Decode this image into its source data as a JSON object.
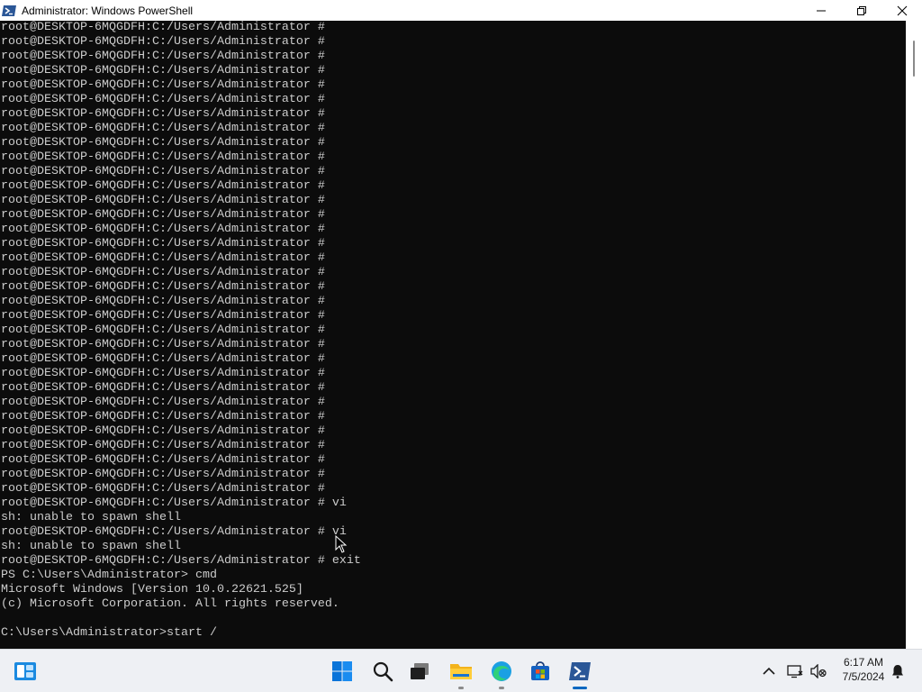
{
  "window": {
    "title": "Administrator: Windows PowerShell",
    "icon": "powershell-icon",
    "controls": [
      "minimize-icon",
      "restore-icon",
      "close-icon"
    ]
  },
  "terminal": {
    "lines": [
      "root@DESKTOP-6MQGDFH:C:/Users/Administrator #",
      "root@DESKTOP-6MQGDFH:C:/Users/Administrator #",
      "root@DESKTOP-6MQGDFH:C:/Users/Administrator #",
      "root@DESKTOP-6MQGDFH:C:/Users/Administrator #",
      "root@DESKTOP-6MQGDFH:C:/Users/Administrator #",
      "root@DESKTOP-6MQGDFH:C:/Users/Administrator #",
      "root@DESKTOP-6MQGDFH:C:/Users/Administrator #",
      "root@DESKTOP-6MQGDFH:C:/Users/Administrator #",
      "root@DESKTOP-6MQGDFH:C:/Users/Administrator #",
      "root@DESKTOP-6MQGDFH:C:/Users/Administrator #",
      "root@DESKTOP-6MQGDFH:C:/Users/Administrator #",
      "root@DESKTOP-6MQGDFH:C:/Users/Administrator #",
      "root@DESKTOP-6MQGDFH:C:/Users/Administrator #",
      "root@DESKTOP-6MQGDFH:C:/Users/Administrator #",
      "root@DESKTOP-6MQGDFH:C:/Users/Administrator #",
      "root@DESKTOP-6MQGDFH:C:/Users/Administrator #",
      "root@DESKTOP-6MQGDFH:C:/Users/Administrator #",
      "root@DESKTOP-6MQGDFH:C:/Users/Administrator #",
      "root@DESKTOP-6MQGDFH:C:/Users/Administrator #",
      "root@DESKTOP-6MQGDFH:C:/Users/Administrator #",
      "root@DESKTOP-6MQGDFH:C:/Users/Administrator #",
      "root@DESKTOP-6MQGDFH:C:/Users/Administrator #",
      "root@DESKTOP-6MQGDFH:C:/Users/Administrator #",
      "root@DESKTOP-6MQGDFH:C:/Users/Administrator #",
      "root@DESKTOP-6MQGDFH:C:/Users/Administrator #",
      "root@DESKTOP-6MQGDFH:C:/Users/Administrator #",
      "root@DESKTOP-6MQGDFH:C:/Users/Administrator #",
      "root@DESKTOP-6MQGDFH:C:/Users/Administrator #",
      "root@DESKTOP-6MQGDFH:C:/Users/Administrator #",
      "root@DESKTOP-6MQGDFH:C:/Users/Administrator #",
      "root@DESKTOP-6MQGDFH:C:/Users/Administrator #",
      "root@DESKTOP-6MQGDFH:C:/Users/Administrator #",
      "root@DESKTOP-6MQGDFH:C:/Users/Administrator #",
      "root@DESKTOP-6MQGDFH:C:/Users/Administrator # vi",
      "sh: unable to spawn shell",
      "root@DESKTOP-6MQGDFH:C:/Users/Administrator # vi",
      "sh: unable to spawn shell",
      "root@DESKTOP-6MQGDFH:C:/Users/Administrator # exit",
      "PS C:\\Users\\Administrator> cmd",
      "Microsoft Windows [Version 10.0.22621.525]",
      "(c) Microsoft Corporation. All rights reserved.",
      "",
      "C:\\Users\\Administrator>start /"
    ],
    "colors": {
      "background": "#0c0c0c",
      "foreground": "#cccccc"
    }
  },
  "taskbar": {
    "widgets_icon": "widgets-icon",
    "apps": [
      {
        "name": "start-button",
        "icon": "windows-start-icon",
        "active": false
      },
      {
        "name": "search-button",
        "icon": "search-icon",
        "active": false
      },
      {
        "name": "task-view-button",
        "icon": "task-view-icon",
        "active": false
      },
      {
        "name": "file-explorer-button",
        "icon": "folder-icon",
        "active": false,
        "running": true
      },
      {
        "name": "edge-button",
        "icon": "edge-icon",
        "active": false,
        "running": true
      },
      {
        "name": "store-button",
        "icon": "store-icon",
        "active": false
      },
      {
        "name": "powershell-button",
        "icon": "powershell-icon",
        "active": true
      }
    ],
    "tray": {
      "time": "6:17 AM",
      "date": "7/5/2024",
      "icons": [
        "chevron-up-icon",
        "network-icon",
        "volume-muted-icon",
        "notification-icon"
      ]
    },
    "colors": {
      "accent": "#0067c0",
      "background": "#eef0f4"
    }
  }
}
